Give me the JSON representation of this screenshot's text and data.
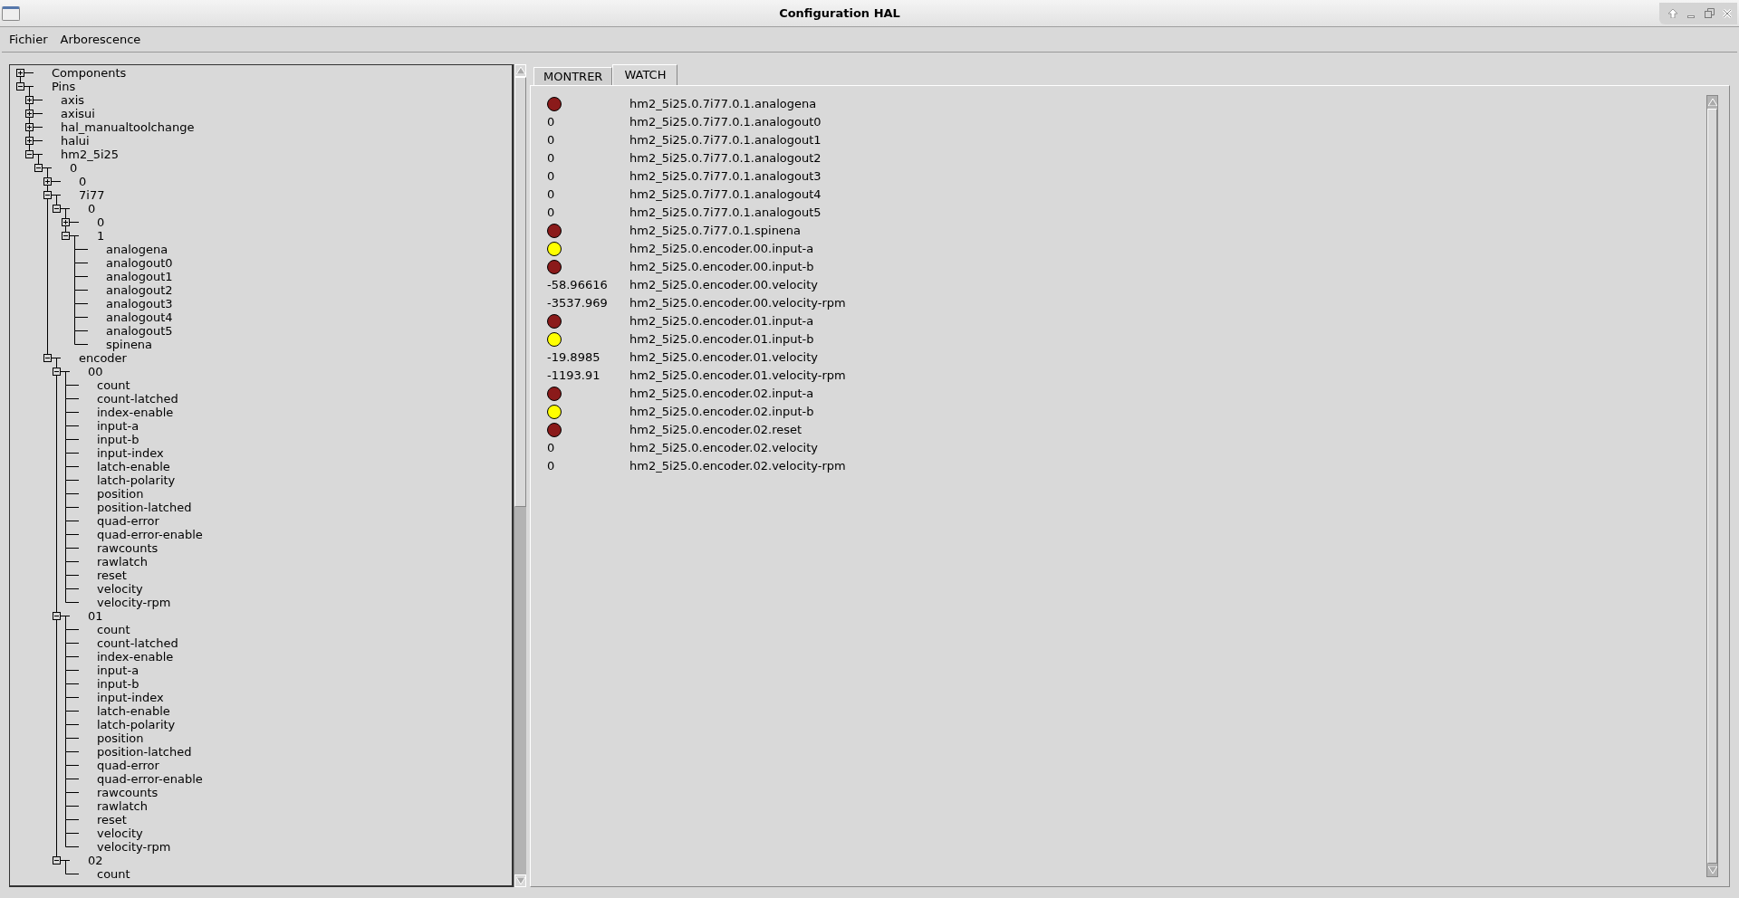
{
  "window": {
    "title": "Configuration HAL"
  },
  "menu": [
    "Fichier",
    "Arborescence"
  ],
  "tree": [
    {
      "label": "Components",
      "expanded": false
    },
    {
      "label": "Pins",
      "expanded": true,
      "children": [
        {
          "label": "axis",
          "expanded": false
        },
        {
          "label": "axisui",
          "expanded": false
        },
        {
          "label": "hal_manualtoolchange",
          "expanded": false
        },
        {
          "label": "halui",
          "expanded": false
        },
        {
          "label": "hm2_5i25",
          "expanded": true,
          "children": [
            {
              "label": "0",
              "expanded": true,
              "children": [
                {
                  "label": "0",
                  "expanded": false
                },
                {
                  "label": "7i77",
                  "expanded": true,
                  "children": [
                    {
                      "label": "0",
                      "expanded": true,
                      "children": [
                        {
                          "label": "0",
                          "expanded": false
                        },
                        {
                          "label": "1",
                          "expanded": true,
                          "children": [
                            {
                              "label": "analogena"
                            },
                            {
                              "label": "analogout0"
                            },
                            {
                              "label": "analogout1"
                            },
                            {
                              "label": "analogout2"
                            },
                            {
                              "label": "analogout3"
                            },
                            {
                              "label": "analogout4"
                            },
                            {
                              "label": "analogout5"
                            },
                            {
                              "label": "spinena"
                            }
                          ]
                        }
                      ]
                    }
                  ]
                },
                {
                  "label": "encoder",
                  "expanded": true,
                  "children": [
                    {
                      "label": "00",
                      "expanded": true,
                      "children": [
                        {
                          "label": "count"
                        },
                        {
                          "label": "count-latched"
                        },
                        {
                          "label": "index-enable"
                        },
                        {
                          "label": "input-a"
                        },
                        {
                          "label": "input-b"
                        },
                        {
                          "label": "input-index"
                        },
                        {
                          "label": "latch-enable"
                        },
                        {
                          "label": "latch-polarity"
                        },
                        {
                          "label": "position"
                        },
                        {
                          "label": "position-latched"
                        },
                        {
                          "label": "quad-error"
                        },
                        {
                          "label": "quad-error-enable"
                        },
                        {
                          "label": "rawcounts"
                        },
                        {
                          "label": "rawlatch"
                        },
                        {
                          "label": "reset"
                        },
                        {
                          "label": "velocity"
                        },
                        {
                          "label": "velocity-rpm"
                        }
                      ]
                    },
                    {
                      "label": "01",
                      "expanded": true,
                      "children": [
                        {
                          "label": "count"
                        },
                        {
                          "label": "count-latched"
                        },
                        {
                          "label": "index-enable"
                        },
                        {
                          "label": "input-a"
                        },
                        {
                          "label": "input-b"
                        },
                        {
                          "label": "input-index"
                        },
                        {
                          "label": "latch-enable"
                        },
                        {
                          "label": "latch-polarity"
                        },
                        {
                          "label": "position"
                        },
                        {
                          "label": "position-latched"
                        },
                        {
                          "label": "quad-error"
                        },
                        {
                          "label": "quad-error-enable"
                        },
                        {
                          "label": "rawcounts"
                        },
                        {
                          "label": "rawlatch"
                        },
                        {
                          "label": "reset"
                        },
                        {
                          "label": "velocity"
                        },
                        {
                          "label": "velocity-rpm"
                        }
                      ]
                    },
                    {
                      "label": "02",
                      "expanded": true,
                      "children": [
                        {
                          "label": "count"
                        }
                      ]
                    }
                  ]
                }
              ]
            }
          ]
        }
      ]
    }
  ],
  "tabs": [
    {
      "label": "MONTRER",
      "selected": false
    },
    {
      "label": "WATCH",
      "selected": true
    }
  ],
  "watch": [
    {
      "kind": "bit",
      "on": false,
      "name": "hm2_5i25.0.7i77.0.1.analogena"
    },
    {
      "kind": "value",
      "value": "0",
      "name": "hm2_5i25.0.7i77.0.1.analogout0"
    },
    {
      "kind": "value",
      "value": "0",
      "name": "hm2_5i25.0.7i77.0.1.analogout1"
    },
    {
      "kind": "value",
      "value": "0",
      "name": "hm2_5i25.0.7i77.0.1.analogout2"
    },
    {
      "kind": "value",
      "value": "0",
      "name": "hm2_5i25.0.7i77.0.1.analogout3"
    },
    {
      "kind": "value",
      "value": "0",
      "name": "hm2_5i25.0.7i77.0.1.analogout4"
    },
    {
      "kind": "value",
      "value": "0",
      "name": "hm2_5i25.0.7i77.0.1.analogout5"
    },
    {
      "kind": "bit",
      "on": false,
      "name": "hm2_5i25.0.7i77.0.1.spinena"
    },
    {
      "kind": "bit",
      "on": true,
      "name": "hm2_5i25.0.encoder.00.input-a"
    },
    {
      "kind": "bit",
      "on": false,
      "name": "hm2_5i25.0.encoder.00.input-b"
    },
    {
      "kind": "value",
      "value": "-58.96616",
      "name": "hm2_5i25.0.encoder.00.velocity"
    },
    {
      "kind": "value",
      "value": "-3537.969",
      "name": "hm2_5i25.0.encoder.00.velocity-rpm"
    },
    {
      "kind": "bit",
      "on": false,
      "name": "hm2_5i25.0.encoder.01.input-a"
    },
    {
      "kind": "bit",
      "on": true,
      "name": "hm2_5i25.0.encoder.01.input-b"
    },
    {
      "kind": "value",
      "value": "-19.8985",
      "name": "hm2_5i25.0.encoder.01.velocity"
    },
    {
      "kind": "value",
      "value": "-1193.91",
      "name": "hm2_5i25.0.encoder.01.velocity-rpm"
    },
    {
      "kind": "bit",
      "on": false,
      "name": "hm2_5i25.0.encoder.02.input-a"
    },
    {
      "kind": "bit",
      "on": true,
      "name": "hm2_5i25.0.encoder.02.input-b"
    },
    {
      "kind": "bit",
      "on": false,
      "name": "hm2_5i25.0.encoder.02.reset"
    },
    {
      "kind": "value",
      "value": "0",
      "name": "hm2_5i25.0.encoder.02.velocity"
    },
    {
      "kind": "value",
      "value": "0",
      "name": "hm2_5i25.0.encoder.02.velocity-rpm"
    }
  ]
}
